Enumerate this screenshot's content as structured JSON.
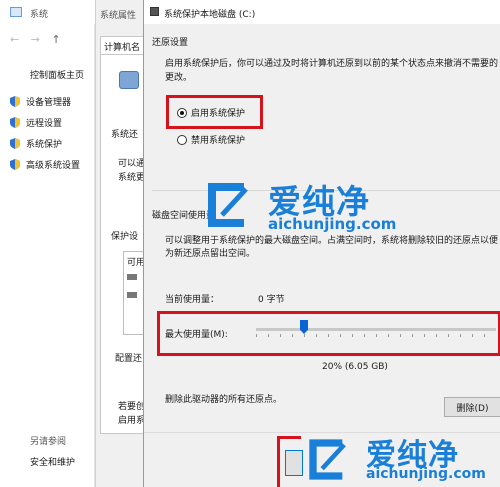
{
  "system_window": {
    "title": "系统",
    "sidebar_link": "控制面板主页",
    "items": [
      {
        "label": "设备管理器",
        "icon": "shield-icon"
      },
      {
        "label": "远程设置",
        "icon": "shield-icon"
      },
      {
        "label": "系统保护",
        "icon": "shield-icon"
      },
      {
        "label": "高级系统设置",
        "icon": "shield-icon"
      }
    ],
    "see_also": "另请参阅",
    "security": "安全和维护"
  },
  "sys_props": {
    "title": "系统属性",
    "tab": "计算机名",
    "fragments": {
      "sys_label": "系统还",
      "can_use": "可以通",
      "sys_change": "系统更",
      "protect": "保护设",
      "avail": "可用",
      "config": "配置还",
      "need": "若要创",
      "enable": "启用系"
    }
  },
  "dialog": {
    "title": "系统保护本地磁盘 (C:)",
    "restore_section": "还原设置",
    "restore_desc": "启用系统保护后，你可以通过及时将计算机还原到以前的某个状态点来撤消不需要的更改。",
    "radio_on": "启用系统保护",
    "radio_off": "禁用系统保护",
    "disk_section": "磁盘空间使用量",
    "disk_desc": "可以调整用于系统保护的最大磁盘空间。占满空间时，系统将删除较旧的还原点以便为新还原点留出空间。",
    "current_label": "当前使用量：",
    "current_value": "0 字节",
    "max_label": "最大使用量(M):",
    "slider_percent": 0.2,
    "slider_value_text": "20% (6.05 GB)",
    "delete_text": "删除此驱动器的所有还原点。",
    "delete_button": "删除(D)"
  },
  "watermark": {
    "text_cn": "爱纯净",
    "url": "aichunjing.com"
  },
  "colors": {
    "highlight": "#d4131c",
    "watermark_blue": "#1a7fd8",
    "accent": "#0a64d6"
  }
}
